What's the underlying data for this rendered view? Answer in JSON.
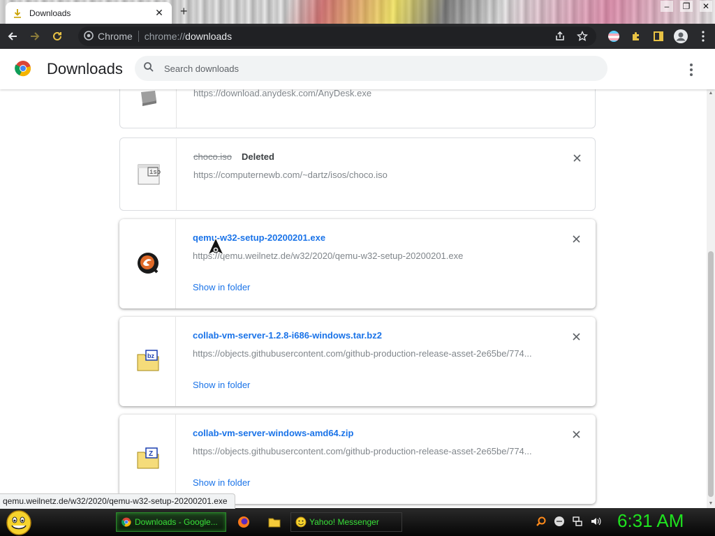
{
  "browser": {
    "tab_title": "Downloads",
    "site_chip": "Chrome",
    "url_scheme": "chrome://",
    "url_path": "downloads"
  },
  "page": {
    "title": "Downloads",
    "search_placeholder": "Search downloads"
  },
  "downloads": [
    {
      "file_name": "",
      "status": "",
      "url": "https://download.anydesk.com/AnyDesk.exe",
      "show_in_folder": "",
      "icon": "anydesk-file-icon"
    },
    {
      "file_name": "choco.iso",
      "status": "Deleted",
      "url": "https://computernewb.com/~dartz/isos/choco.iso",
      "show_in_folder": "",
      "icon": "iso-file-icon"
    },
    {
      "file_name": "qemu-w32-setup-20200201.exe",
      "status": "",
      "url": "https://qemu.weilnetz.de/w32/2020/qemu-w32-setup-20200201.exe",
      "show_in_folder": "Show in folder",
      "icon": "qemu-file-icon"
    },
    {
      "file_name": "collab-vm-server-1.2.8-i686-windows.tar.bz2",
      "status": "",
      "url": "https://objects.githubusercontent.com/github-production-release-asset-2e65be/774...",
      "show_in_folder": "Show in folder",
      "icon": "bz2-archive-icon"
    },
    {
      "file_name": "collab-vm-server-windows-amd64.zip",
      "status": "",
      "url": "https://objects.githubusercontent.com/github-production-release-asset-2e65be/774...",
      "show_in_folder": "Show in folder",
      "icon": "zip-archive-icon"
    }
  ],
  "status_bar": {
    "hover_url": "qemu.weilnetz.de/w32/2020/qemu-w32-setup-20200201.exe"
  },
  "taskbar": {
    "tasks": [
      {
        "label": "Downloads - Google...",
        "icon": "chrome-icon",
        "active": true
      },
      {
        "label": "Yahoo! Messenger",
        "icon": "yahoo-messenger-icon",
        "active": false
      }
    ],
    "quick_launch": [
      "firefox-icon",
      "folder-icon"
    ],
    "tray_icons": [
      "search-icon",
      "messenger-status-icon",
      "network-icon",
      "volume-icon"
    ],
    "clock": "6:31 AM"
  },
  "colors": {
    "link_blue": "#1a73e8",
    "toolbar_dark": "#292a2d",
    "clock_green": "#1fe21f"
  }
}
